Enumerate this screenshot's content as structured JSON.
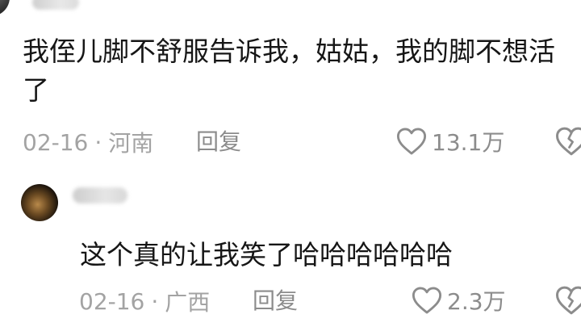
{
  "comments": [
    {
      "text": "我侄儿脚不舒服告诉我，姑姑，我的脚不想活了",
      "date": "02-16",
      "location": "河南",
      "reply_label": "回复",
      "like_count": "13.1万"
    },
    {
      "text": "这个真的让我笑了哈哈哈哈哈哈",
      "date": "02-16",
      "location": "广西",
      "reply_label": "回复",
      "like_count": "2.3万"
    }
  ],
  "separator": "·",
  "icons": {
    "like": "heart-outline-icon",
    "dislike": "broken-heart-icon"
  },
  "colors": {
    "text": "#161616",
    "meta": "#a3a3a3",
    "action": "#8c8c8c",
    "background": "#ffffff"
  }
}
